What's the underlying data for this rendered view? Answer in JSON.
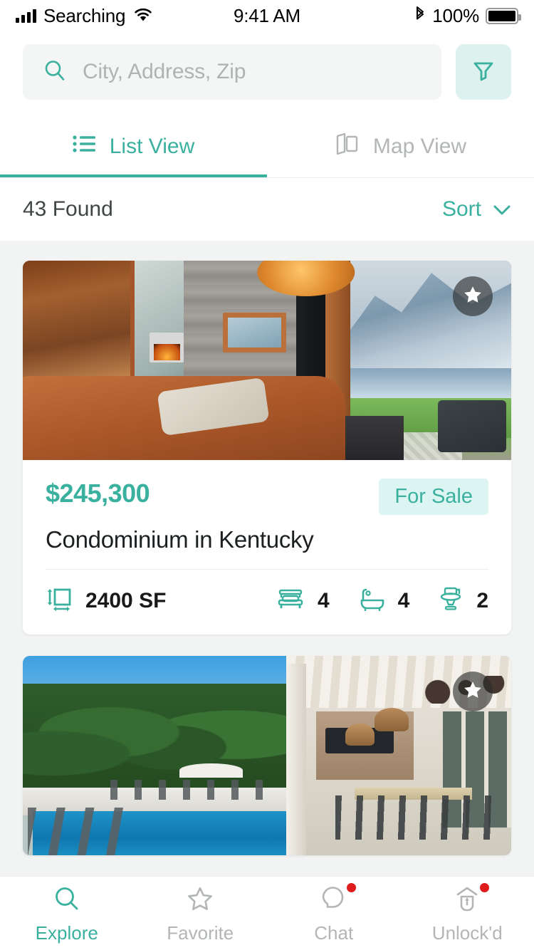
{
  "status_bar": {
    "carrier": "Searching",
    "time": "9:41 AM",
    "battery_percent": "100%",
    "signal_icon": "signal-bars-icon",
    "wifi_icon": "wifi-icon",
    "bluetooth_icon": "bluetooth-icon",
    "battery_icon": "battery-icon"
  },
  "search": {
    "placeholder": "City, Address, Zip",
    "icon": "search-icon",
    "filter_icon": "filter-funnel-icon"
  },
  "tabs": [
    {
      "label": "List View",
      "icon": "list-icon",
      "active": true
    },
    {
      "label": "Map View",
      "icon": "map-icon",
      "active": false
    }
  ],
  "results": {
    "count_label": "43 Found",
    "sort_label": "Sort",
    "sort_icon": "chevron-down-icon"
  },
  "listings": [
    {
      "price": "$245,300",
      "status": "For Sale",
      "title": "Condominium in Kentucky",
      "area": "2400 SF",
      "beds": "4",
      "baths": "4",
      "toilets": "2",
      "favorite_icon": "star-filled-icon",
      "area_icon": "area-icon",
      "bed_icon": "bed-icon",
      "bath_icon": "bathtub-icon",
      "toilet_icon": "toilet-icon",
      "photo_alt": "modern-living-room-with-lake-view"
    },
    {
      "favorite_icon": "star-filled-icon",
      "photo_alt": "pool-and-covered-patio"
    }
  ],
  "bottom_nav": [
    {
      "label": "Explore",
      "icon": "search-icon",
      "active": true,
      "badge": false
    },
    {
      "label": "Favorite",
      "icon": "star-outline-icon",
      "active": false,
      "badge": false
    },
    {
      "label": "Chat",
      "icon": "chat-bubble-icon",
      "active": false,
      "badge": true
    },
    {
      "label": "Unlock'd",
      "icon": "lock-house-icon",
      "active": false,
      "badge": true
    }
  ],
  "colors": {
    "accent": "#3ab09e",
    "accent_soft": "#ddf2ef",
    "badge_bg": "#ddf5f2",
    "muted": "#b3b6b6",
    "page_bg": "#f2f3f3",
    "badge_dot": "#e01b1b"
  }
}
